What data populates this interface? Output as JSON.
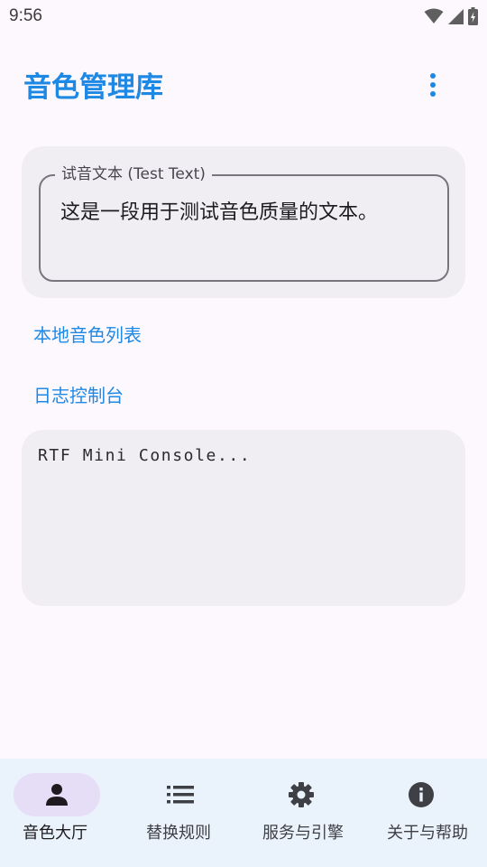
{
  "status_bar": {
    "time": "9:56",
    "icons": [
      "wifi-icon",
      "cellular-signal-icon",
      "battery-charging-icon"
    ]
  },
  "app_bar": {
    "title": "音色管理库",
    "title_color": "#1e88e5",
    "menu_icon": "more-vertical-icon"
  },
  "test_text": {
    "label": "试音文本 (Test Text)",
    "value": "这是一段用于测试音色质量的文本。"
  },
  "sections": {
    "local_voices": "本地音色列表",
    "log_console": "日志控制台"
  },
  "console": {
    "text": "RTF Mini Console..."
  },
  "bottom_nav": {
    "items": [
      {
        "label": "音色大厅",
        "icon": "person-icon",
        "active": true
      },
      {
        "label": "替换规则",
        "icon": "list-icon",
        "active": false
      },
      {
        "label": "服务与引擎",
        "icon": "gear-icon",
        "active": false
      },
      {
        "label": "关于与帮助",
        "icon": "info-icon",
        "active": false
      }
    ]
  },
  "colors": {
    "accent": "#1e88e5",
    "background": "#fdf8fd",
    "card": "#f1eef3",
    "nav_background": "#eaf2fb",
    "nav_active_indicator": "#e6def6"
  }
}
